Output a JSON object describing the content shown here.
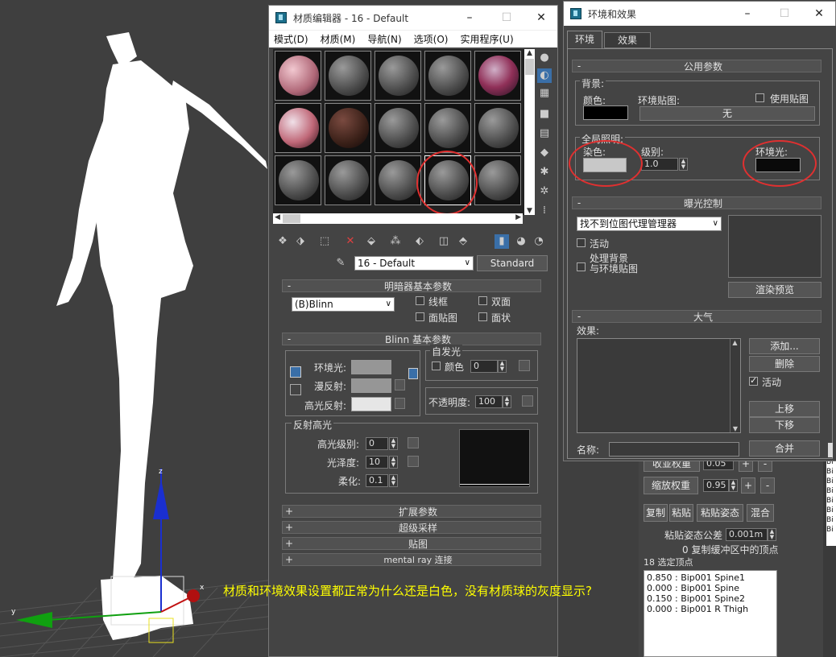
{
  "mat_editor": {
    "title": "材质编辑器 - 16 - Default",
    "menu": [
      "模式(D)",
      "材质(M)",
      "导航(N)",
      "选项(O)",
      "实用程序(U)"
    ],
    "material_name": "16 - Default",
    "material_type": "Standard",
    "shader_rollout": {
      "title": "明暗器基本参数",
      "shader": "(B)Blinn",
      "options": [
        "线框",
        "双面",
        "面贴图",
        "面状"
      ]
    },
    "blinn_rollout": {
      "title": "Blinn 基本参数",
      "ambient": "环境光:",
      "diffuse": "漫反射:",
      "specular": "高光反射:",
      "self_illum": "自发光",
      "self_illum_color": "颜色",
      "self_illum_value": "0",
      "opacity_label": "不透明度:",
      "opacity_value": "100"
    },
    "spec_group": {
      "title": "反射高光",
      "level_label": "高光级别:",
      "level_value": "0",
      "gloss_label": "光泽度:",
      "gloss_value": "10",
      "soften_label": "柔化:",
      "soften_value": "0.1"
    },
    "collapsed_rollouts": [
      "扩展参数",
      "超级采样",
      "贴图",
      "mental ray 连接"
    ]
  },
  "env_dialog": {
    "title": "环境和效果",
    "tabs": [
      "环境",
      "效果"
    ],
    "common": {
      "title": "公用参数",
      "background": "背景:",
      "color": "颜色:",
      "env_map": "环境贴图:",
      "use_map": "使用贴图",
      "none_btn": "无",
      "global_lighting": "全局照明:",
      "tint": "染色:",
      "level": "级别:",
      "level_value": "1.0",
      "ambient": "环境光:"
    },
    "exposure": {
      "title": "曝光控制",
      "dropdown": "找不到位图代理管理器",
      "active": "活动",
      "process_bg": "处理背景",
      "with_env": "与环境贴图",
      "render_preview": "渲染预览"
    },
    "atmosphere": {
      "title": "大气",
      "effects": "效果:",
      "add": "添加...",
      "delete": "删除",
      "active": "活动",
      "move_up": "上移",
      "move_down": "下移",
      "name": "名称:",
      "merge": "合并"
    }
  },
  "cmd_panel": {
    "row1_label": "收並权重",
    "row1_value": "0.05",
    "scale_weight": "缩放权重",
    "scale_value": "0.95",
    "copy": "复制",
    "paste": "粘贴",
    "paste_pose": "粘贴姿态",
    "blend": "混合",
    "tolerance_label": "粘贴姿态公差",
    "tolerance_value": "0.001m",
    "buffer_info": "0 复制缓冲区中的顶点",
    "selected_info": "18 选定顶点",
    "weights": [
      "0.850 : Bip001 Spine1",
      "0.000 : Bip001 Spine",
      "0.150 : Bip001 Spine2",
      "0.000 : Bip001 R Thigh"
    ],
    "right_items": [
      "Bi",
      "Bi",
      "Bi",
      "Bi",
      "Bi",
      "Bi",
      "Bi",
      "Bi"
    ]
  },
  "question": "材质和环境效果设置都正常为什么还是白色，没有材质球的灰度显示?",
  "viewport_axis": {
    "x": "x",
    "y": "y",
    "z": "z"
  },
  "colors": {
    "annotation": "#ffff00",
    "circle": "#e03030",
    "axis_z": "#1a2fd0",
    "axis_x": "#c01010",
    "axis_y": "#10a010"
  }
}
